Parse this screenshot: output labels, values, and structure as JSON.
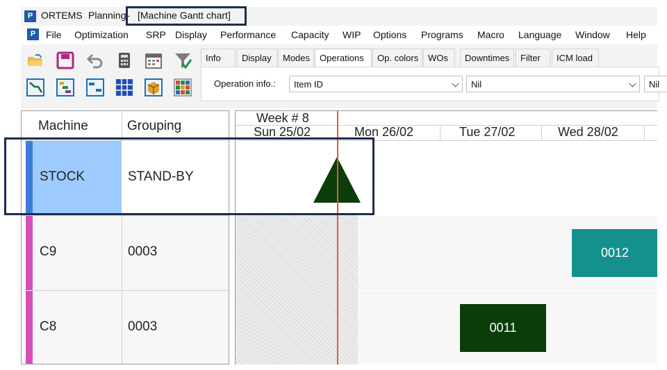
{
  "app": {
    "logo_letter": "P",
    "name": "ORTEMS",
    "module": "Planning",
    "separator": " - ",
    "window_title": "[Machine Gantt chart]"
  },
  "menu": [
    "File",
    "Optimization",
    "SRP",
    "Display",
    "Performance",
    "Capacity",
    "WIP",
    "Options",
    "Programs",
    "Macro",
    "Language",
    "Window",
    "Help"
  ],
  "toolbar_icons": [
    "open-folder-icon",
    "save-icon",
    "undo-icon",
    "calculator-icon",
    "calendar-icon",
    "filter-icon",
    "gantt-view-icon",
    "load-chart-icon",
    "sequence-icon",
    "table-grid-icon",
    "package-icon",
    "palette-grid-icon"
  ],
  "tabs": {
    "items": [
      "Info",
      "Display",
      "Modes",
      "Operations",
      "Op. colors",
      "WOs",
      "Downtimes",
      "Filter",
      "ICM load"
    ],
    "active": "Operations"
  },
  "operation_info": {
    "label": "Operation info.:",
    "combo1_value": "Item ID",
    "combo2_value": "Nil",
    "combo3_value": "Nil"
  },
  "grid": {
    "headers": {
      "machine": "Machine",
      "grouping": "Grouping"
    },
    "rows": [
      {
        "machine": "STOCK",
        "grouping": "STAND-BY",
        "color": "#3b7dd8",
        "selected_color": "#9ecbff"
      },
      {
        "machine": "C9",
        "grouping": "0003",
        "color": "#d64fb8"
      },
      {
        "machine": "C8",
        "grouping": "0003",
        "color": "#d64fb8"
      }
    ]
  },
  "gantt": {
    "week": "Week # 8",
    "days": [
      "Sun 25/02",
      "Mon 26/02",
      "Tue 27/02",
      "Wed 28/02"
    ],
    "operations": [
      {
        "label": "0012",
        "color": "#14908d"
      },
      {
        "label": "0011",
        "color": "#0a3d0a"
      }
    ],
    "stock_marker_color": "#0a3d0a"
  }
}
